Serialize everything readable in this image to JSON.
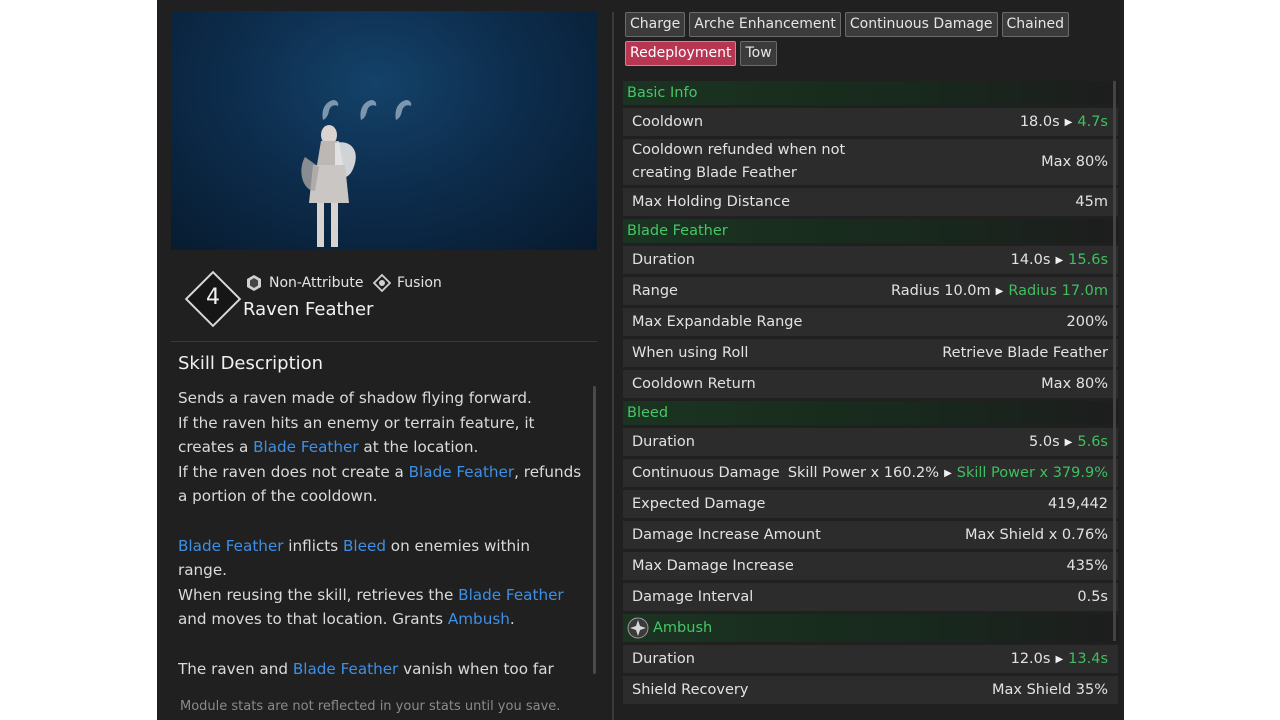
{
  "skill": {
    "rank": "4",
    "attributes": [
      {
        "icon": "non-attribute-icon",
        "label": "Non-Attribute"
      },
      {
        "icon": "fusion-icon",
        "label": "Fusion"
      }
    ],
    "name": "Raven Feather"
  },
  "description": {
    "title": "Skill Description",
    "lines": {
      "l1": "Sends a raven made of shadow flying forward.",
      "l2": "If the raven hits an enemy or terrain feature, it",
      "l3a": "creates a ",
      "l3b": "Blade Feather",
      "l3c": " at the location.",
      "l4a": "If the raven does not create a ",
      "l4b": "Blade Feather",
      "l4c": ", refunds",
      "l5": "a portion of the cooldown.",
      "l6a": "Blade Feather",
      "l6b": " inflicts ",
      "l6c": "Bleed",
      "l6d": " on enemies within",
      "l7": "range.",
      "l8a": "When reusing the skill, retrieves the ",
      "l8b": "Blade Feather",
      "l9a": "and moves to that location. Grants ",
      "l9b": "Ambush",
      "l9c": ".",
      "l10a": "The raven and ",
      "l10b": "Blade Feather",
      "l10c": " vanish when too far"
    }
  },
  "footer_note": "Module stats are not reflected in your stats until you save.",
  "tags": {
    "row1": [
      "Charge",
      "Arche Enhancement",
      "Continuous Damage",
      "Chained"
    ],
    "row2": [
      {
        "label": "Redeployment",
        "active": true
      },
      {
        "label": "Tow",
        "active": false
      }
    ]
  },
  "sections": {
    "basic": {
      "title": "Basic Info",
      "cooldown": {
        "name": "Cooldown",
        "old": "18.0s",
        "new": "4.7s"
      },
      "refund": {
        "name_line1": "Cooldown refunded when not",
        "name_line2": "creating Blade Feather",
        "value": "Max 80%"
      },
      "holding": {
        "name": "Max Holding Distance",
        "value": "45m"
      }
    },
    "blade": {
      "title": "Blade Feather",
      "duration": {
        "name": "Duration",
        "old": "14.0s",
        "new": "15.6s"
      },
      "range": {
        "name": "Range",
        "old": "Radius 10.0m",
        "new": "Radius 17.0m"
      },
      "expandable": {
        "name": "Max Expandable Range",
        "value": "200%"
      },
      "roll": {
        "name": "When using Roll",
        "value": "Retrieve Blade Feather"
      },
      "cdreturn": {
        "name": "Cooldown Return",
        "value": "Max 80%"
      }
    },
    "bleed": {
      "title": "Bleed",
      "duration": {
        "name": "Duration",
        "old": "5.0s",
        "new": "5.6s"
      },
      "contdmg": {
        "name": "Continuous Damage",
        "old": "Skill Power x 160.2%",
        "new": "Skill Power x 379.9%"
      },
      "expected": {
        "name": "Expected Damage",
        "value": "419,442"
      },
      "incamount": {
        "name": "Damage Increase Amount",
        "value": "Max Shield x 0.76%"
      },
      "maxinc": {
        "name": "Max Damage Increase",
        "value": "435%"
      },
      "interval": {
        "name": "Damage Interval",
        "value": "0.5s"
      }
    },
    "ambush": {
      "title": "Ambush",
      "duration": {
        "name": "Duration",
        "old": "12.0s",
        "new": "13.4s"
      },
      "shield": {
        "name": "Shield Recovery",
        "value": "Max Shield 35%"
      }
    }
  },
  "colors": {
    "accent_green": "#45c765",
    "keyword_blue": "#3e8fe6",
    "active_tag": "#b93653"
  }
}
